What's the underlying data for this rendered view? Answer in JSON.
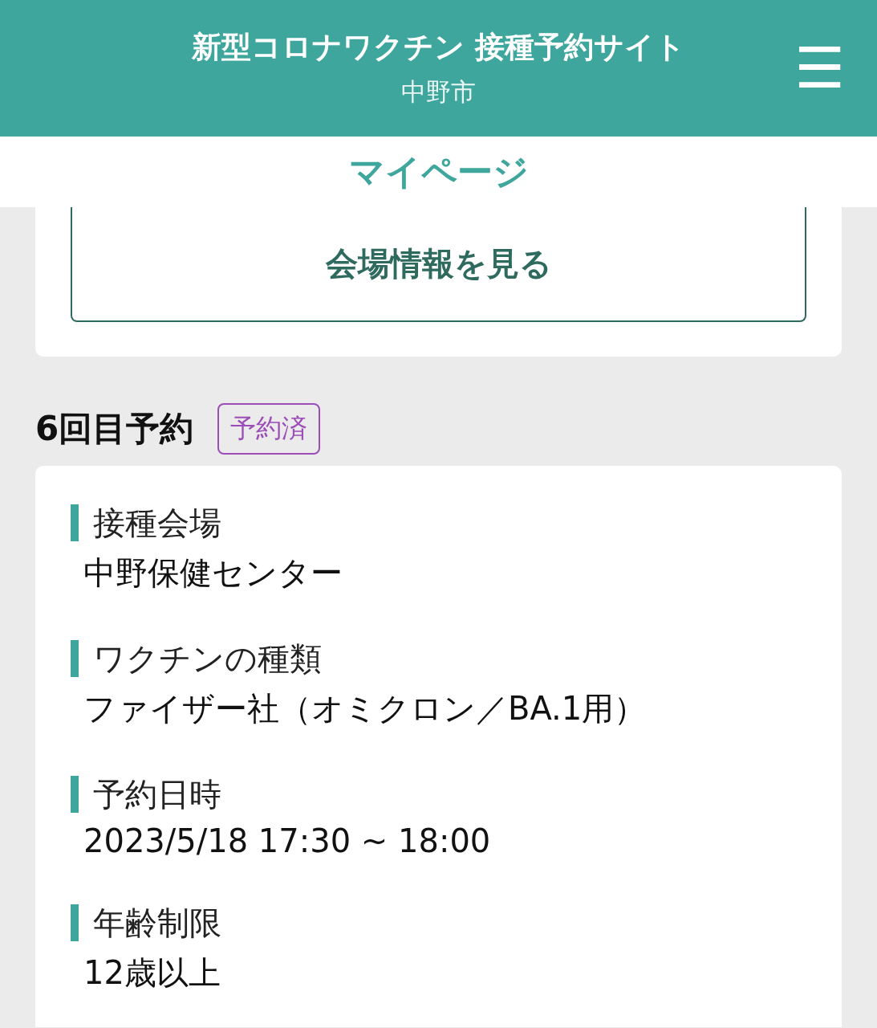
{
  "header": {
    "title": "新型コロナワクチン 接種予約サイト",
    "subtitle": "中野市",
    "menu_icon": "☰"
  },
  "page_title": "マイページ",
  "venue_button": "会場情報を見る",
  "reservation": {
    "heading": "6回目予約",
    "badge": "予約済",
    "fields": [
      {
        "label": "接種会場",
        "value": "中野保健センター"
      },
      {
        "label": "ワクチンの種類",
        "value": "ファイザー社（オミクロン／BA.1用）"
      },
      {
        "label": "予約日時",
        "value": "2023/5/18 17:30 ~ 18:00"
      },
      {
        "label": "年齢制限",
        "value": "12歳以上"
      }
    ]
  }
}
